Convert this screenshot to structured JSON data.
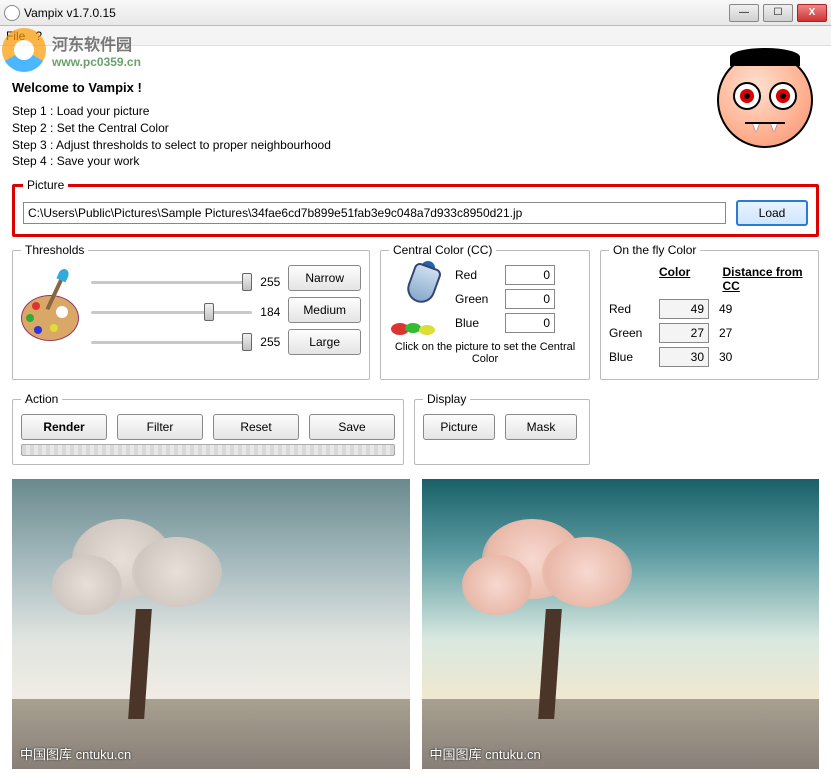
{
  "window": {
    "title": "Vampix v1.7.0.15",
    "min": "—",
    "max": "☐",
    "close": "X"
  },
  "menu": {
    "file": "File",
    "question": "?"
  },
  "watermark": {
    "name": "河东软件园",
    "url": "www.pc0359.cn"
  },
  "welcome": "Welcome to Vampix !",
  "steps": {
    "s1": "Step 1 : Load your picture",
    "s2": "Step 2 : Set the Central Color",
    "s3": "Step 3 : Adjust thresholds to select to proper neighbourhood",
    "s4": "Step 4 : Save your work"
  },
  "picture": {
    "legend": "Picture",
    "path": "C:\\Users\\Public\\Pictures\\Sample Pictures\\34fae6cd7b899e51fab3e9c048a7d933c8950d21.jp",
    "load": "Load"
  },
  "thresholds": {
    "legend": "Thresholds",
    "v1": "255",
    "v2": "184",
    "v3": "255",
    "narrow": "Narrow",
    "medium": "Medium",
    "large": "Large"
  },
  "cc": {
    "legend": "Central Color (CC)",
    "red": "Red",
    "green": "Green",
    "blue": "Blue",
    "rv": "0",
    "gv": "0",
    "bv": "0",
    "note": "Click on the picture to set the Central Color"
  },
  "otf": {
    "legend": "On the fly Color",
    "h1": "Color",
    "h2": "Distance from CC",
    "red": "Red",
    "green": "Green",
    "blue": "Blue",
    "rv": "49",
    "gv": "27",
    "bv": "30",
    "rd": "49",
    "gd": "27",
    "bd": "30"
  },
  "action": {
    "legend": "Action",
    "render": "Render",
    "filter": "Filter",
    "reset": "Reset",
    "save": "Save"
  },
  "display": {
    "legend": "Display",
    "picture": "Picture",
    "mask": "Mask"
  },
  "caption": "中国图库 cntuku.cn"
}
